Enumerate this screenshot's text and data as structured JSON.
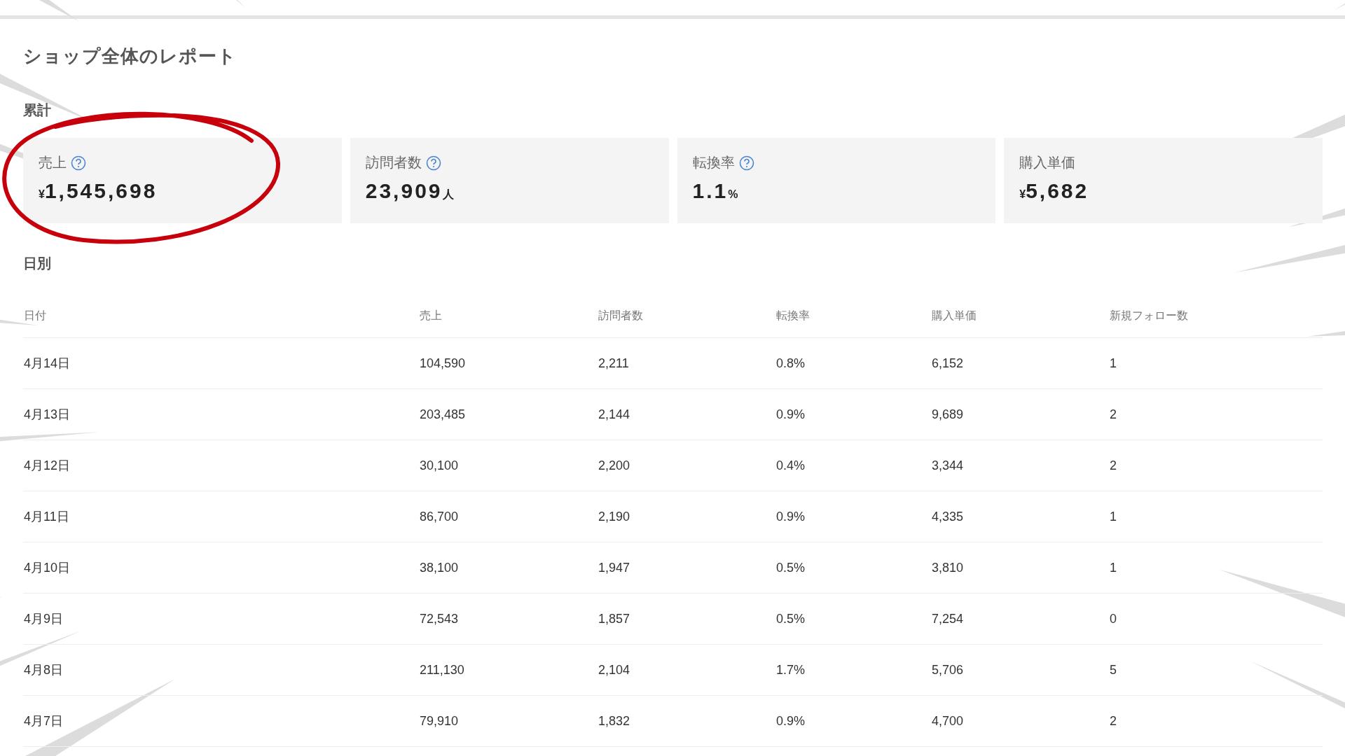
{
  "title": "ショップ全体のレポート",
  "summary": {
    "heading": "累計",
    "cards": [
      {
        "label": "売上",
        "help": true,
        "prefix": "¥",
        "value": "1,545,698",
        "circled": true
      },
      {
        "label": "訪問者数",
        "help": true,
        "value": "23,909",
        "suffix": "人",
        "circled": false
      },
      {
        "label": "転換率",
        "help": true,
        "value": "1.1",
        "suffix": "%",
        "circled": false
      },
      {
        "label": "購入単価",
        "help": false,
        "prefix": "¥",
        "value": "5,682",
        "circled": false
      }
    ]
  },
  "daily": {
    "heading": "日別",
    "columns": [
      "日付",
      "売上",
      "訪問者数",
      "転換率",
      "購入単価",
      "新規フォロー数"
    ],
    "rows": [
      [
        "4月14日",
        "104,590",
        "2,211",
        "0.8%",
        "6,152",
        "1"
      ],
      [
        "4月13日",
        "203,485",
        "2,144",
        "0.9%",
        "9,689",
        "2"
      ],
      [
        "4月12日",
        "30,100",
        "2,200",
        "0.4%",
        "3,344",
        "2"
      ],
      [
        "4月11日",
        "86,700",
        "2,190",
        "0.9%",
        "4,335",
        "1"
      ],
      [
        "4月10日",
        "38,100",
        "1,947",
        "0.5%",
        "3,810",
        "1"
      ],
      [
        "4月9日",
        "72,543",
        "1,857",
        "0.5%",
        "7,254",
        "0"
      ],
      [
        "4月8日",
        "211,130",
        "2,104",
        "1.7%",
        "5,706",
        "5"
      ],
      [
        "4月7日",
        "79,910",
        "1,832",
        "0.9%",
        "4,700",
        "2"
      ]
    ]
  }
}
